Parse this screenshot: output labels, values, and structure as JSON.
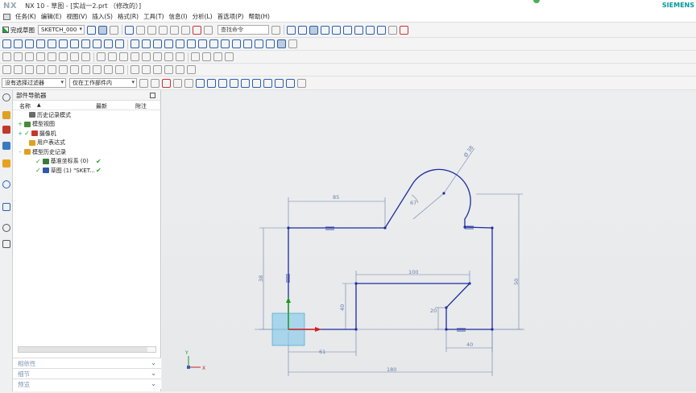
{
  "window": {
    "title": "NX 10 - 草图 - [实战一2.prt （修改的）]",
    "brand": "SIEMENS"
  },
  "menu": {
    "items": [
      "任务(K)",
      "编辑(E)",
      "视图(V)",
      "插入(S)",
      "格式(R)",
      "工具(T)",
      "信息(I)",
      "分析(L)",
      "首选项(P)",
      "帮助(H)"
    ]
  },
  "toolbar": {
    "finish_label": "完成草图",
    "sketch_name": "SKETCH_000",
    "search_placeholder": "查找命令"
  },
  "selection_bar": {
    "filter": "没有选择过滤器",
    "scope": "仅在工作部件内"
  },
  "navigator": {
    "title": "部件导航器",
    "columns": {
      "name": "名称",
      "latest": "最新",
      "attached": "附注"
    },
    "items": [
      {
        "label": "历史记录模式",
        "expand": "",
        "icon_color": "#6a6a6a",
        "checked": false,
        "ok": false
      },
      {
        "label": "模型视图",
        "expand": "+",
        "icon_color": "#4a8a3a",
        "checked": false,
        "ok": false
      },
      {
        "label": "摄像机",
        "expand": "+",
        "icon_color": "#c0392b",
        "checked": true,
        "ok": false
      },
      {
        "label": "用户表达式",
        "expand": "",
        "icon_color": "#e0a020",
        "checked": false,
        "ok": false
      },
      {
        "label": "模型历史记录",
        "expand": "-",
        "icon_color": "#e0a020",
        "checked": false,
        "ok": false
      },
      {
        "label": "基准坐标系 (0)",
        "expand": "",
        "icon_color": "#3a7a3a",
        "checked": true,
        "ok": true
      },
      {
        "label": "草图 (1) \"SKET...",
        "expand": "",
        "icon_color": "#2e5aa8",
        "checked": true,
        "ok": true
      }
    ],
    "panels": [
      "相依性",
      "细节",
      "预览"
    ]
  },
  "sketch": {
    "dimensions": {
      "top_width": "85",
      "radius": "Ø 38",
      "angle": "67",
      "total_height": "50",
      "left_height": "38",
      "inner_width": "100",
      "inner_height": "40",
      "notch_height": "20",
      "bottom_offset": "40",
      "bottom_left": "61",
      "total_width": "180"
    },
    "colors": {
      "profile": "#1f2c9e",
      "dimension": "#6c7fa8",
      "axis_x": "#d02020",
      "axis_y": "#1a9a1a"
    },
    "triad": {
      "x": "X",
      "y": "Y"
    }
  }
}
